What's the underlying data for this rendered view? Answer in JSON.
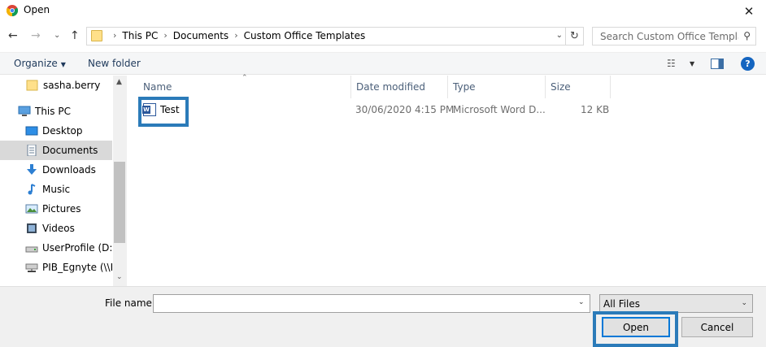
{
  "window": {
    "title": "Open",
    "close_glyph": "✕"
  },
  "nav": {
    "back_glyph": "←",
    "forward_glyph": "→",
    "recent_glyph": "⌄",
    "up_glyph": "↑"
  },
  "address": {
    "crumbs": [
      "This PC",
      "Documents",
      "Custom Office Templates"
    ],
    "separator": "›",
    "dropdown_glyph": "⌄",
    "refresh_glyph": "↻"
  },
  "search": {
    "placeholder": "Search Custom Office Templa...",
    "icon_glyph": "⚲"
  },
  "toolbar": {
    "organize_label": "Organize",
    "organize_caret": "▼",
    "new_folder_label": "New folder",
    "view_glyph": "☷",
    "view_caret": "▼",
    "help_label": "?"
  },
  "sidebar": {
    "items": [
      {
        "label": "sasha.berry",
        "icon": "user-folder-icon",
        "selected": false
      },
      {
        "label": "This PC",
        "icon": "computer-icon",
        "selected": false
      },
      {
        "label": "Desktop",
        "icon": "desktop-icon",
        "selected": false
      },
      {
        "label": "Documents",
        "icon": "documents-icon",
        "selected": true
      },
      {
        "label": "Downloads",
        "icon": "downloads-icon",
        "selected": false
      },
      {
        "label": "Music",
        "icon": "music-icon",
        "selected": false
      },
      {
        "label": "Pictures",
        "icon": "pictures-icon",
        "selected": false
      },
      {
        "label": "Videos",
        "icon": "videos-icon",
        "selected": false
      },
      {
        "label": "UserProfile (D:)",
        "icon": "drive-icon",
        "selected": false
      },
      {
        "label": "PIB_Egnyte (\\\\Eg",
        "icon": "network-drive-icon",
        "selected": false
      }
    ],
    "scroll_up_glyph": "▲",
    "scroll_down_glyph": "⌄"
  },
  "columns": [
    {
      "label": "Name"
    },
    {
      "label": "Date modified"
    },
    {
      "label": "Type"
    },
    {
      "label": "Size"
    }
  ],
  "sort_glyph": "⌃",
  "files": [
    {
      "name": "Test",
      "date": "30/06/2020 4:15 PM",
      "type": "Microsoft Word D...",
      "size": "12 KB",
      "icon": "word-document-icon"
    }
  ],
  "bottom": {
    "file_name_label": "File name:",
    "file_name_value": "",
    "file_name_dropdown_glyph": "⌄",
    "filter_value": "All Files",
    "filter_caret": "⌄",
    "open_label": "Open",
    "cancel_label": "Cancel"
  },
  "colors": {
    "highlight_border": "#2b7bb9",
    "selected_nav": "#d9d9d9",
    "link_text": "#1e395b",
    "help_blue": "#1565c0",
    "word_blue": "#2b579a"
  }
}
